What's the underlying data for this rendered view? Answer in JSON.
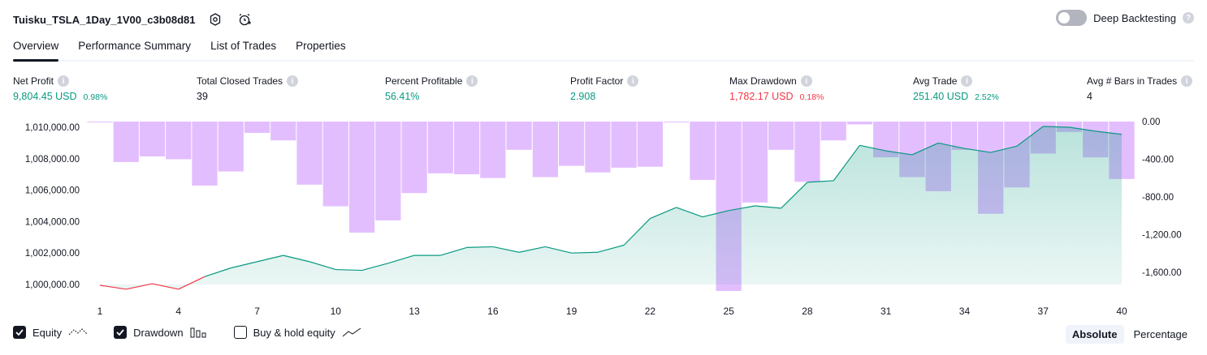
{
  "header": {
    "title": "Tuisku_TSLA_1Day_1V00_c3b08d81",
    "deep_backtesting_label": "Deep Backtesting",
    "deep_backtesting_enabled": false
  },
  "tabs": [
    {
      "label": "Overview",
      "active": true
    },
    {
      "label": "Performance Summary",
      "active": false
    },
    {
      "label": "List of Trades",
      "active": false
    },
    {
      "label": "Properties",
      "active": false
    }
  ],
  "metrics": [
    {
      "label": "Net Profit",
      "value": "9,804.45 USD",
      "pct": "0.98%",
      "color": "#089981"
    },
    {
      "label": "Total Closed Trades",
      "value": "39",
      "pct": "",
      "color": "#131722"
    },
    {
      "label": "Percent Profitable",
      "value": "56.41%",
      "pct": "",
      "color": "#089981"
    },
    {
      "label": "Profit Factor",
      "value": "2.908",
      "pct": "",
      "color": "#089981"
    },
    {
      "label": "Max Drawdown",
      "value": "1,782.17 USD",
      "pct": "0.18%",
      "color": "#f23645"
    },
    {
      "label": "Avg Trade",
      "value": "251.40 USD",
      "pct": "2.52%",
      "color": "#089981"
    },
    {
      "label": "Avg # Bars in Trades",
      "value": "4",
      "pct": "",
      "color": "#131722"
    }
  ],
  "chart_data": {
    "type": "line",
    "x_ticks": [
      "1",
      "4",
      "7",
      "10",
      "13",
      "16",
      "19",
      "22",
      "25",
      "28",
      "31",
      "34",
      "37",
      "40"
    ],
    "left_axis": {
      "ticks": [
        "1,000,000.00",
        "1,002,000.00",
        "1,004,000.00",
        "1,006,000.00",
        "1,008,000.00",
        "1,010,000.00"
      ],
      "range": [
        999000,
        1011000
      ]
    },
    "right_axis": {
      "ticks": [
        "0.00",
        "-400.00",
        "-800.00",
        "-1,200.00",
        "-1,600.00"
      ],
      "range": [
        -1800,
        0
      ]
    },
    "series": [
      {
        "name": "Equity",
        "color_up": "#089981",
        "color_down": "#f23645",
        "values": [
          999950,
          999700,
          1000050,
          999700,
          1000500,
          1001050,
          1001450,
          1001850,
          1001450,
          1000950,
          1000900,
          1001350,
          1001850,
          1001850,
          1002350,
          1002400,
          1002050,
          1002400,
          1002000,
          1002050,
          1002500,
          1004200,
          1004900,
          1004300,
          1004700,
          1005000,
          1004850,
          1006500,
          1006600,
          1008850,
          1008500,
          1008250,
          1009000,
          1008650,
          1008400,
          1008800,
          1010050,
          1010000,
          1009750,
          1009550
        ]
      },
      {
        "name": "Drawdown",
        "color": "#c77dff",
        "values": [
          0,
          -430,
          -370,
          -400,
          -680,
          -530,
          -120,
          -200,
          -670,
          -900,
          -1180,
          -1050,
          -760,
          -550,
          -560,
          -600,
          -300,
          -590,
          -470,
          -540,
          -490,
          -480,
          0,
          -620,
          -1800,
          -860,
          -300,
          -640,
          -200,
          -30,
          -380,
          -590,
          -740,
          -300,
          -980,
          -700,
          -340,
          -110,
          -380,
          -610
        ]
      }
    ],
    "legend": [
      {
        "label": "Equity",
        "checked": true
      },
      {
        "label": "Drawdown",
        "checked": true
      },
      {
        "label": "Buy & hold equity",
        "checked": false
      }
    ]
  },
  "view_toggle": {
    "options": [
      "Absolute",
      "Percentage"
    ],
    "selected": "Absolute"
  }
}
